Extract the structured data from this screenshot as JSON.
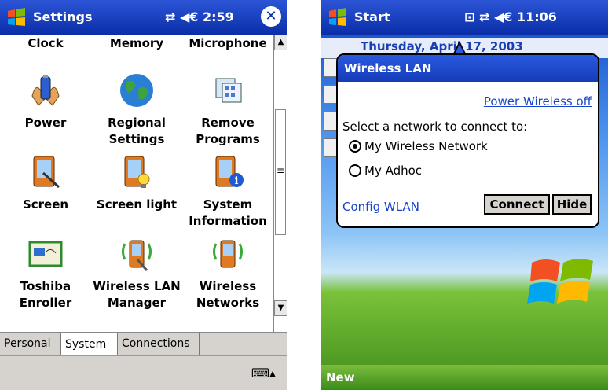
{
  "left": {
    "title": "Settings",
    "status_text": "⇄ ◀€ 2:59",
    "close_glyph": "✕",
    "top_row": [
      "Clock",
      "Memory",
      "Microphone"
    ],
    "items": [
      {
        "label": "Power",
        "icon": "power-icon"
      },
      {
        "label": "Regional Settings",
        "icon": "globe-icon"
      },
      {
        "label": "Remove Programs",
        "icon": "remove-programs-icon"
      },
      {
        "label": "Screen",
        "icon": "screen-icon"
      },
      {
        "label": "Screen light",
        "icon": "screen-light-icon"
      },
      {
        "label": "System Information",
        "icon": "system-info-icon"
      },
      {
        "label": "Toshiba Enroller",
        "icon": "certificate-icon"
      },
      {
        "label": "Wireless LAN Manager",
        "icon": "wireless-icon"
      },
      {
        "label": "Wireless Networks",
        "icon": "wireless-networks-icon"
      }
    ],
    "tabs": [
      "Personal",
      "System",
      "Connections"
    ],
    "active_tab": "System",
    "scroll_up": "▲",
    "scroll_down": "▼",
    "scroll_grip": "≡",
    "keyboard_glyph": "⌨▴"
  },
  "right": {
    "title": "Start",
    "status_text": "⊡ ⇄ ◀€ 11:06",
    "date": "Thursday, April 17, 2003",
    "popup": {
      "title": "Wireless LAN",
      "power_link": "Power Wireless off",
      "prompt": "Select a network to connect to:",
      "networks": [
        {
          "name": "My Wireless Network",
          "selected": true
        },
        {
          "name": "My Adhoc",
          "selected": false
        }
      ],
      "config_link": "Config WLAN",
      "connect_label": "Connect",
      "hide_label": "Hide"
    },
    "bottom_label": "New"
  }
}
